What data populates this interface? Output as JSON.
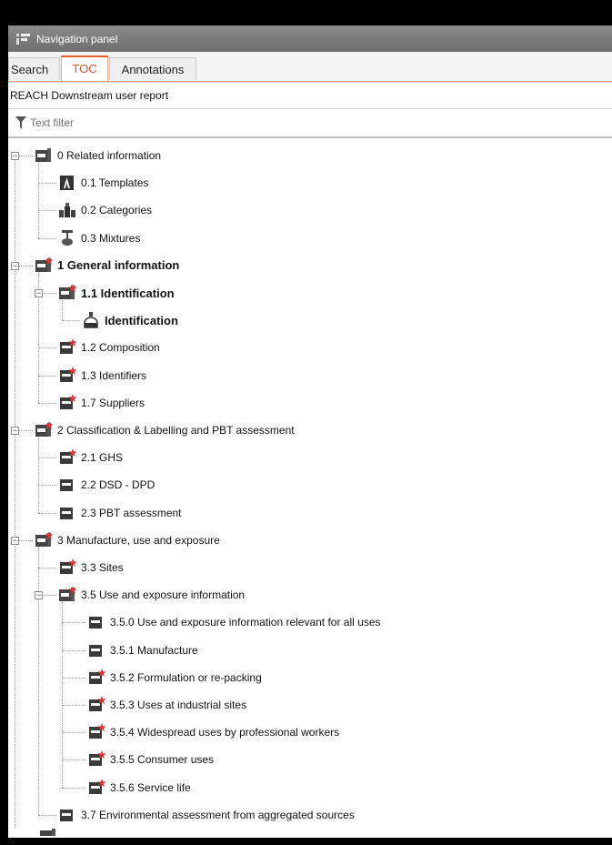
{
  "panel": {
    "title": "Navigation panel"
  },
  "tabs": [
    {
      "label": "Search",
      "active": false
    },
    {
      "label": "TOC",
      "active": true
    },
    {
      "label": "Annotations",
      "active": false
    }
  ],
  "report_title": "REACH Downstream user report",
  "filter": {
    "placeholder": "Text filter",
    "value": ""
  },
  "tree": [
    {
      "label": "0 Related information",
      "icon": "section-folder-icon",
      "bold": false
    },
    {
      "label": "0.1 Templates",
      "icon": "template-icon",
      "bold": false
    },
    {
      "label": "0.2 Categories",
      "icon": "categories-icon",
      "bold": false
    },
    {
      "label": "0.3 Mixtures",
      "icon": "mixture-flask-icon",
      "bold": false
    },
    {
      "label": "1 General information",
      "icon": "section-folder-required-icon",
      "bold": true
    },
    {
      "label": "1.1 Identification",
      "icon": "section-folder-required-icon",
      "bold": true
    },
    {
      "label": "Identification",
      "icon": "substance-flask-icon",
      "bold": true
    },
    {
      "label": "1.2 Composition",
      "icon": "document-required-icon",
      "bold": false
    },
    {
      "label": "1.3 Identifiers",
      "icon": "document-required-icon",
      "bold": false
    },
    {
      "label": "1.7 Suppliers",
      "icon": "document-required-icon",
      "bold": false
    },
    {
      "label": "2 Classification & Labelling and PBT assessment",
      "icon": "section-folder-required-icon",
      "bold": false
    },
    {
      "label": "2.1 GHS",
      "icon": "document-required-icon",
      "bold": false
    },
    {
      "label": "2.2 DSD - DPD",
      "icon": "document-icon",
      "bold": false
    },
    {
      "label": "2.3 PBT assessment",
      "icon": "document-icon",
      "bold": false
    },
    {
      "label": "3 Manufacture, use and exposure",
      "icon": "section-folder-required-icon",
      "bold": false
    },
    {
      "label": "3.3 Sites",
      "icon": "document-required-icon",
      "bold": false
    },
    {
      "label": "3.5 Use and exposure information",
      "icon": "section-folder-required-icon",
      "bold": false
    },
    {
      "label": "3.5.0 Use and exposure information relevant for all uses",
      "icon": "document-icon",
      "bold": false
    },
    {
      "label": "3.5.1 Manufacture",
      "icon": "document-icon",
      "bold": false
    },
    {
      "label": "3.5.2 Formulation or re-packing",
      "icon": "document-required-icon",
      "bold": false
    },
    {
      "label": "3.5.3 Uses at industrial sites",
      "icon": "document-required-icon",
      "bold": false
    },
    {
      "label": "3.5.4 Widespread uses by professional workers",
      "icon": "document-required-icon",
      "bold": false
    },
    {
      "label": "3.5.5 Consumer uses",
      "icon": "document-required-icon",
      "bold": false
    },
    {
      "label": "3.5.6 Service life",
      "icon": "document-required-icon",
      "bold": false
    },
    {
      "label": "3.7 Environmental assessment from aggregated sources",
      "icon": "document-icon",
      "bold": false
    }
  ],
  "colors": {
    "accent": "#e8602e",
    "required_star": "#e0303a",
    "icon_dark": "#3a3a3a"
  }
}
